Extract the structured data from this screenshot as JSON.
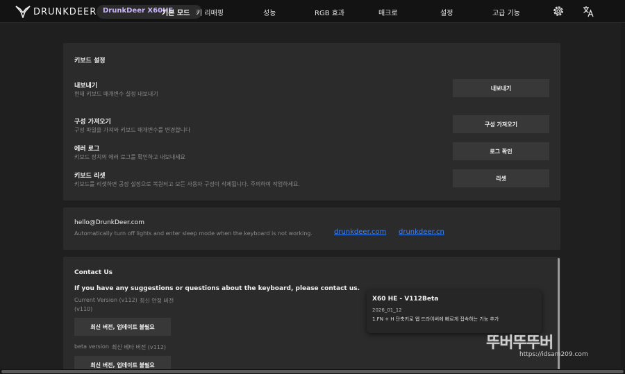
{
  "header": {
    "brand": "DRUNKDEER",
    "device": "DrunkDeer X60HE",
    "nav": [
      "기본 모드",
      "키 리매핑",
      "성능",
      "RGB 효과",
      "매크로",
      "설정",
      "고급 기능"
    ],
    "icons": [
      "gear-icon",
      "translate-icon"
    ]
  },
  "keyboard_settings": {
    "title": "키보드 설정",
    "rows": [
      {
        "title": "내보내기",
        "desc": "현재 키보드 매개변수 설정 내보내기",
        "button": "내보내기"
      },
      {
        "title": "구성 가져오기",
        "desc": "구성 파일을 가져와 키보드 매개변수를 변경합니다",
        "button": "구성 가져오기"
      },
      {
        "title": "에러 로그",
        "desc": "키보드 장치의 에러 로그를 확인하고 내보내세요",
        "button": "로그 확인"
      },
      {
        "title": "키보드 리셋",
        "desc": "키보드를 리셋하면 공장 설정으로 복원되고 모든 사용자 구성이 삭제됩니다. 주의하여 작업하세요.",
        "button": "리셋"
      }
    ]
  },
  "contact_email": {
    "email": "hello@DrunkDeer.com",
    "desc": "Automatically turn off lights and enter sleep mode when the keyboard is not working.",
    "links": [
      "drunkdeer.com",
      "drunkdeer.cn"
    ]
  },
  "contact_us": {
    "title": "Contact Us",
    "subtitle": "If you have any suggestions or questions about the keyboard, please contact us.",
    "current_version_label": "Current Version (v112)",
    "current_version_note": "최신 안정 버전",
    "current_version_sub": "(v110)",
    "update_button_1": "최신 버전, 업데이트 불필요",
    "beta_label": "beta version",
    "beta_note": "최신 베타 버전 (v112)",
    "update_button_2": "최신 버전, 업데이트 불필요"
  },
  "popup": {
    "title": "X60 HE - V112Beta",
    "date": "2026_01_12",
    "text": "1.FN + H 단축키로 웹 드라이버에 빠르게 접속하는 기능 추가"
  },
  "watermark": {
    "text": "뚜버뚜뚜버",
    "url": "https://idsam209.com"
  }
}
